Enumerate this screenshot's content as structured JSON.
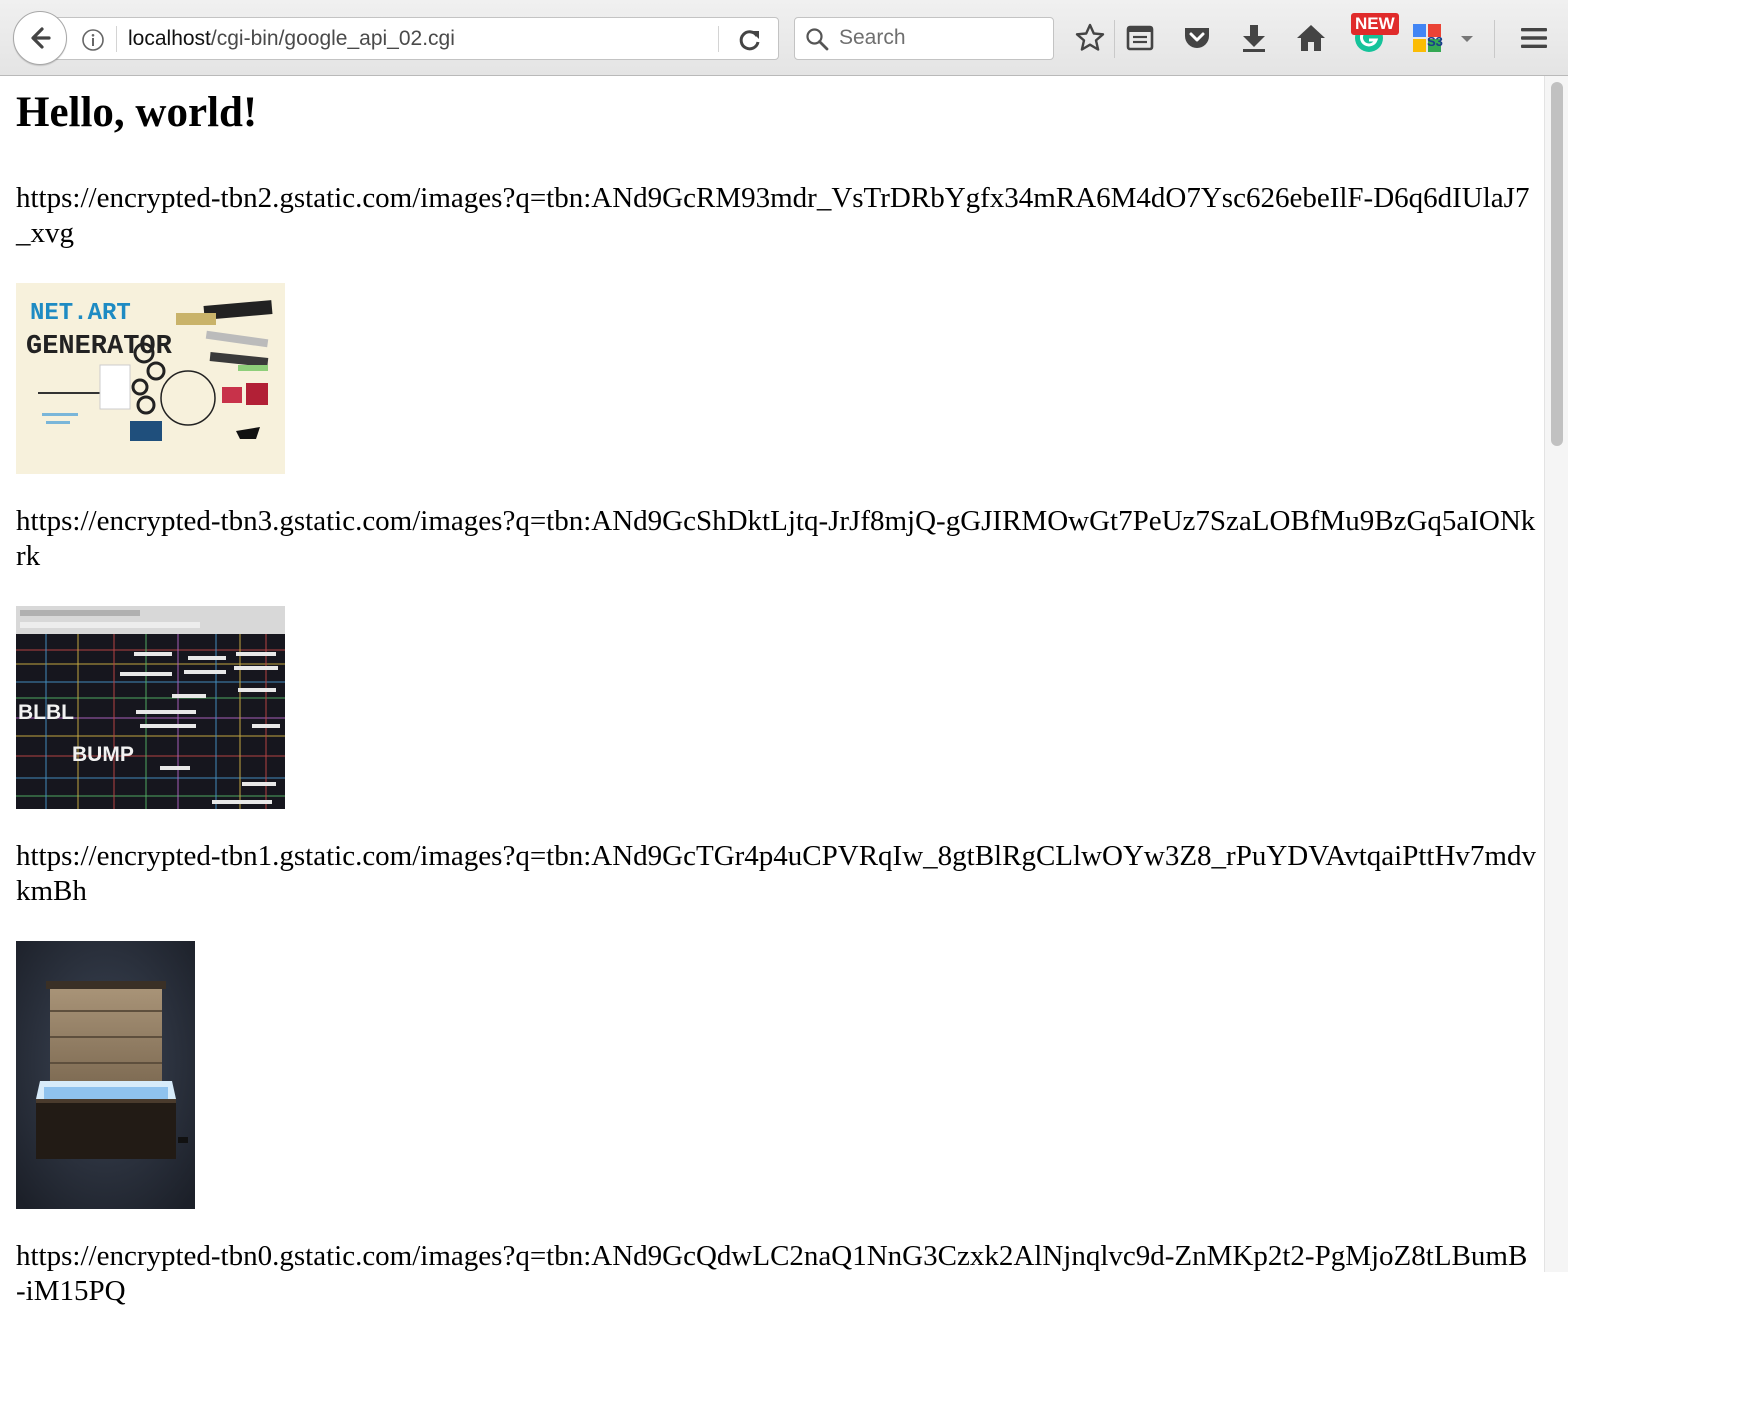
{
  "browser": {
    "url_host": "localhost",
    "url_path": "/cgi-bin/google_api_02.cgi",
    "search_placeholder": "Search",
    "new_badge": "NEW"
  },
  "page": {
    "heading": "Hello, world!",
    "results": [
      {
        "url": "https://encrypted-tbn2.gstatic.com/images?q=tbn:ANd9GcRM93mdr_VsTrDRbYgfx34mRA6M4dO7Ysc626ebeIlF-D6q6dIUlaJ7_xvg",
        "thumb": "net-art-generator-thumbnail",
        "thumb_text": [
          "NET.ART",
          "GENERATOR"
        ]
      },
      {
        "url": "https://encrypted-tbn3.gstatic.com/images?q=tbn:ANd9GcShDktLjtq-JrJf8mjQ-gGJIRMOwGt7PeUz7SzaLOBfMu9BzGq5aIONkrk",
        "thumb": "dark-grid-website-thumbnail",
        "thumb_text": [
          "BLBL",
          "BUMP"
        ]
      },
      {
        "url": "https://encrypted-tbn1.gstatic.com/images?q=tbn:ANd9GcTGr4p4uCPVRqIw_8gtBlRgCLlwOYw3Z8_rPuYDVAvtqaiPttHv7mdvkmBh",
        "thumb": "lit-wooden-box-thumbnail"
      },
      {
        "url": "https://encrypted-tbn0.gstatic.com/images?q=tbn:ANd9GcQdwLC2naQ1NnG3Czxk2AlNjnqlvc9d-ZnMKp2t2-PgMjoZ8tLBumB-iM15PQ"
      }
    ]
  },
  "colors": {
    "toolbar_bg": "#e8e8e8",
    "badge_red": "#e02b2b",
    "grammarly_green": "#15c39a"
  }
}
